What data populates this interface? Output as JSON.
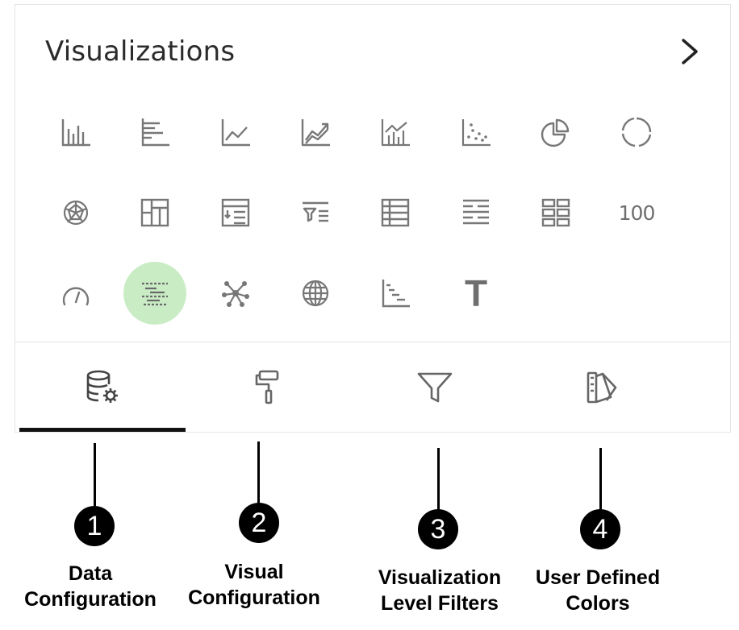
{
  "panel": {
    "title": "Visualizations",
    "collapse_icon": "chevron-right-icon",
    "icon_rows": [
      [
        "clustered-column-chart-icon",
        "clustered-bar-chart-icon",
        "line-chart-icon",
        "area-chart-icon",
        "line-and-column-chart-icon",
        "scatter-chart-icon",
        "pie-chart-icon",
        "donut-chart-icon"
      ],
      [
        "radar-chart-icon",
        "treemap-icon",
        "matrix-icon",
        "funnel-icon",
        "table-icon",
        "multi-row-card-icon",
        "card-grid-icon",
        "kpi-number-icon"
      ],
      [
        "gauge-icon",
        "gantt-chart-icon",
        "network-graph-icon",
        "map-icon",
        "waterfall-chart-icon",
        "text-icon"
      ]
    ],
    "kpi_number_label": "100",
    "text_icon_label": "T",
    "selected_icon": "gantt-chart-icon",
    "selected_color": "#c9ecc5",
    "tabs": [
      {
        "icon": "database-settings-icon",
        "active": true
      },
      {
        "icon": "paint-roller-icon",
        "active": false
      },
      {
        "icon": "filter-icon",
        "active": false
      },
      {
        "icon": "color-swatch-icon",
        "active": false
      }
    ]
  },
  "callouts": [
    {
      "number": "1",
      "label_line1": "Data",
      "label_line2": "Configuration"
    },
    {
      "number": "2",
      "label_line1": "Visual",
      "label_line2": "Configuration"
    },
    {
      "number": "3",
      "label_line1": "Visualization",
      "label_line2": "Level Filters"
    },
    {
      "number": "4",
      "label_line1": "User Defined",
      "label_line2": "Colors"
    }
  ]
}
